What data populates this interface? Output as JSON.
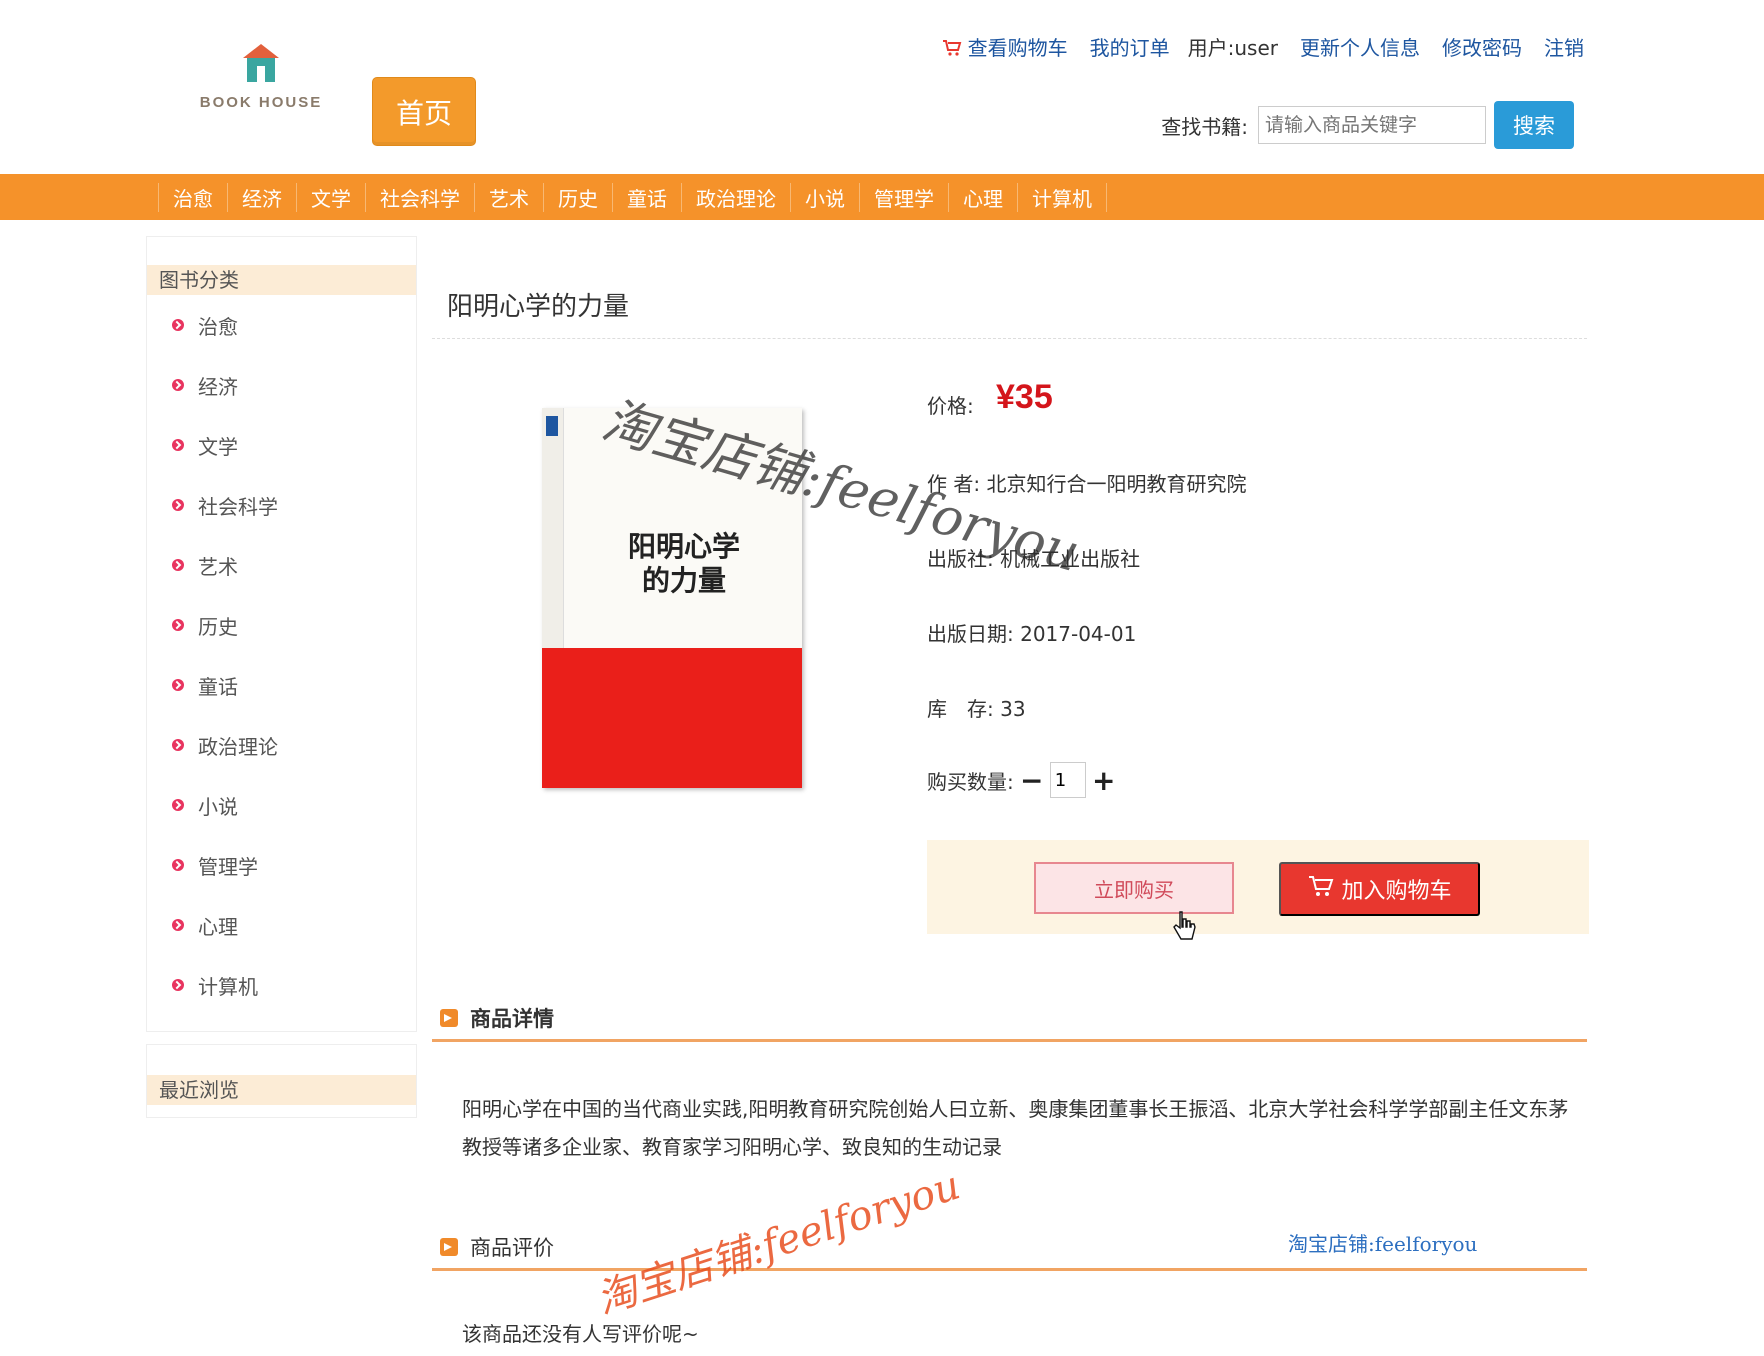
{
  "header": {
    "logo_text": "BOOK HOUSE",
    "home_label": "首页",
    "links": {
      "cart": "查看购物车",
      "orders": "我的订单",
      "user": "用户:user",
      "profile": "更新个人信息",
      "password": "修改密码",
      "logout": "注销"
    },
    "search": {
      "label": "查找书籍:",
      "placeholder": "请输入商品关键字",
      "button": "搜索"
    }
  },
  "nav": [
    "治愈",
    "经济",
    "文学",
    "社会科学",
    "艺术",
    "历史",
    "童话",
    "政治理论",
    "小说",
    "管理学",
    "心理",
    "计算机"
  ],
  "sidebar": {
    "title": "图书分类",
    "items": [
      "治愈",
      "经济",
      "文学",
      "社会科学",
      "艺术",
      "历史",
      "童话",
      "政治理论",
      "小说",
      "管理学",
      "心理",
      "计算机"
    ],
    "recent_title": "最近浏览"
  },
  "product": {
    "title": "阳明心学的力量",
    "cover_title_line1": "阳明心学",
    "cover_title_line2": "的力量",
    "price_label": "价格:",
    "price": "¥35",
    "author": "作 者: 北京知行合一阳明教育研究院",
    "publisher": "出版社: 机械工业出版社",
    "pub_date": "出版日期: 2017-04-01",
    "stock": "库　存: 33",
    "qty_label": "购买数量:",
    "qty_value": "1",
    "buy_now": "立即购买",
    "add_cart": "加入购物车"
  },
  "detail": {
    "heading": "商品详情",
    "text": "阳明心学在中国的当代商业实践,阳明教育研究院创始人曰立新、奥康集团董事长王振滔、北京大学社会科学学部副主任文东茅教授等诸多企业家、教育家学习阳明心学、致良知的生动记录"
  },
  "review": {
    "heading": "商品评价",
    "empty": "该商品还没有人写评价呢~"
  },
  "watermarks": {
    "w1": "淘宝店铺:feelforyou",
    "w2": "淘宝店铺:feelforyou",
    "w3": "淘宝店铺:feelforyou"
  },
  "colors": {
    "orange": "#f5922a",
    "price_red": "#d4151b",
    "link_blue": "#1e56a0",
    "search_blue": "#2a9bd8"
  }
}
